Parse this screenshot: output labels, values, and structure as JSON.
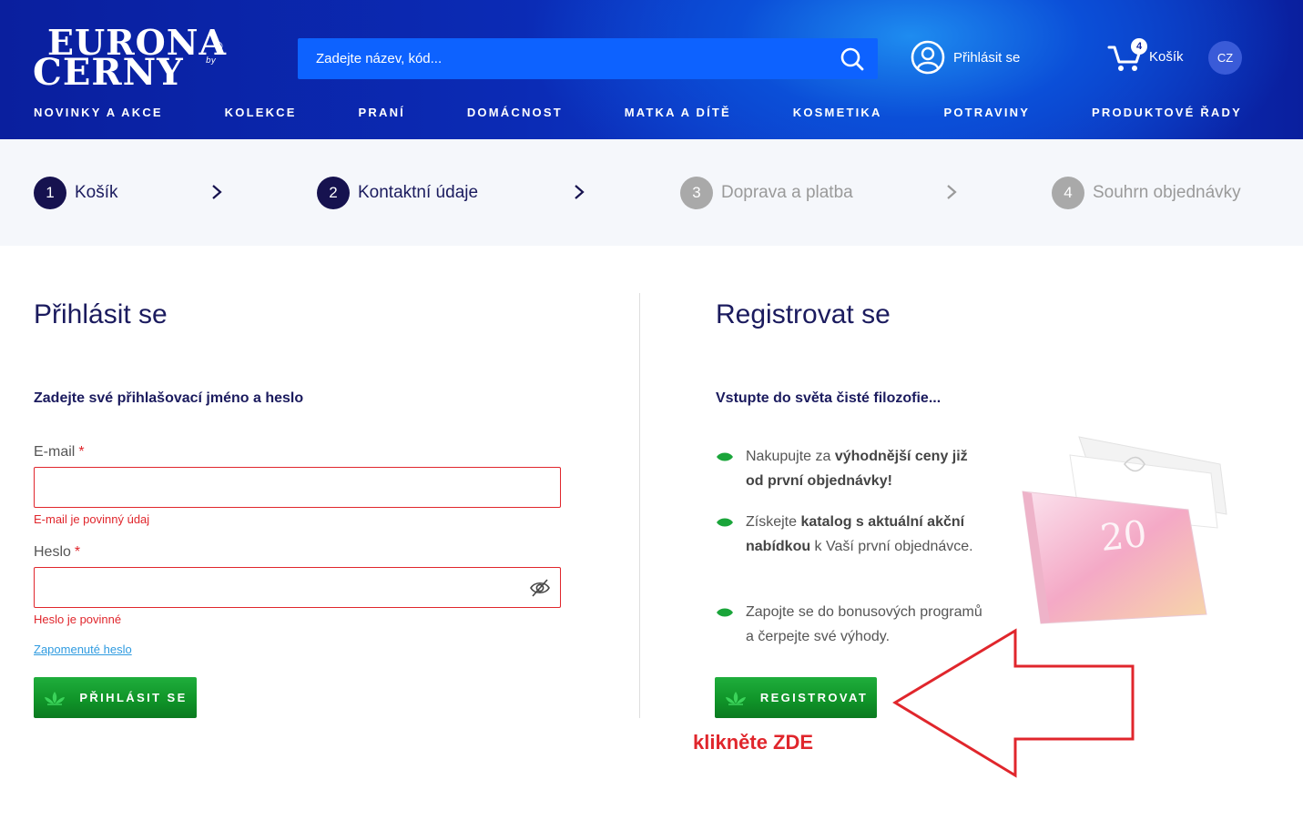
{
  "header": {
    "logo_line1": "EURONA",
    "logo_line2": "CERNY",
    "logo_by": "by",
    "logo_reg": "®",
    "search_placeholder": "Zadejte název, kód...",
    "login_label": "Přihlásit se",
    "cart_label": "Košík",
    "cart_count": "4",
    "lang": "CZ"
  },
  "nav": {
    "items": [
      "NOVINKY A AKCE",
      "KOLEKCE",
      "PRANÍ",
      "DOMÁCNOST",
      "MATKA A DÍTĚ",
      "KOSMETIKA",
      "POTRAVINY",
      "PRODUKTOVÉ ŘADY"
    ]
  },
  "steps": [
    {
      "num": "1",
      "label": "Košík",
      "state": "active"
    },
    {
      "num": "2",
      "label": "Kontaktní údaje",
      "state": "active"
    },
    {
      "num": "3",
      "label": "Doprava a platba",
      "state": "inactive"
    },
    {
      "num": "4",
      "label": "Souhrn objednávky",
      "state": "inactive"
    }
  ],
  "login": {
    "title": "Přihlásit se",
    "subtitle": "Zadejte své přihlašovací jméno a heslo",
    "email_label": "E-mail",
    "email_value": "",
    "email_error": "E-mail je povinný údaj",
    "password_label": "Heslo",
    "password_value": "",
    "password_error": "Heslo je povinné",
    "required_mark": "*",
    "forgot_link": "Zapomenuté heslo",
    "submit_label": "PŘIHLÁSIT SE"
  },
  "register": {
    "title": "Registrovat se",
    "subtitle": "Vstupte do světa čisté filozofie...",
    "benefits": [
      {
        "pre": "Nakupujte za ",
        "bold": "výhodnější ceny již od první objednávky!",
        "post": ""
      },
      {
        "pre": "Získejte ",
        "bold": "katalog s aktuální akční nabídkou",
        "post": " k Vaší první objednávce."
      },
      {
        "pre": "Zapojte se do bonusových programů a čerpejte své výhody.",
        "bold": "",
        "post": ""
      }
    ],
    "submit_label": "REGISTROVAT",
    "cta_text": "klikněte ZDE"
  },
  "colors": {
    "brand_dark": "#16124f",
    "accent_green": "#109529",
    "error_red": "#e0262c",
    "header_blue": "#0b2bb5"
  }
}
